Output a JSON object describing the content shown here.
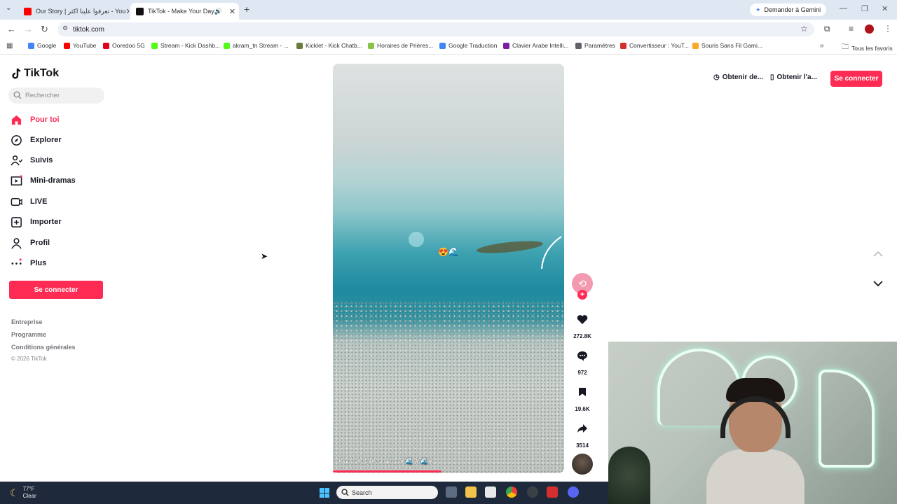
{
  "browser": {
    "tabs": [
      {
        "title": "Our Story | تعرفوا علينا اكثر - You",
        "active": false,
        "favicon_color": "#ff0000"
      },
      {
        "title": "TikTok - Make Your Day",
        "active": true,
        "favicon_color": "#111111"
      }
    ],
    "gemini_label": "Demander à Gemini",
    "url": "tiktok.com",
    "bookmarks": [
      {
        "label": "Google",
        "color": "#4285f4"
      },
      {
        "label": "YouTube",
        "color": "#ff0000"
      },
      {
        "label": "Ooredoo 5G",
        "color": "#e2001a"
      },
      {
        "label": "Stream - Kick Dashb...",
        "color": "#53fc18"
      },
      {
        "label": "akram_tn Stream - ...",
        "color": "#53fc18"
      },
      {
        "label": "Kicklet - Kick Chatb...",
        "color": "#6a7a3a"
      },
      {
        "label": "Horaires de Prières...",
        "color": "#8bc34a"
      },
      {
        "label": "Google Traduction",
        "color": "#4285f4"
      },
      {
        "label": "Clavier Arabe Intelli...",
        "color": "#7b1fa2"
      },
      {
        "label": "Paramètres",
        "color": "#5f6368"
      },
      {
        "label": "Convertisseur : YouT...",
        "color": "#d32f2f"
      },
      {
        "label": "Souris Sans Fil Gami...",
        "color": "#f9a825"
      }
    ],
    "all_bookmarks": "Tous les favoris"
  },
  "sidebar": {
    "logo": "TikTok",
    "search_placeholder": "Rechercher",
    "items": [
      {
        "label": "Pour toi",
        "icon": "home-icon",
        "active": true
      },
      {
        "label": "Explorer",
        "icon": "compass-icon",
        "active": false
      },
      {
        "label": "Suivis",
        "icon": "following-icon",
        "active": false
      },
      {
        "label": "Mini-dramas",
        "icon": "film-icon",
        "active": false
      },
      {
        "label": "LIVE",
        "icon": "live-icon",
        "active": false
      },
      {
        "label": "Importer",
        "icon": "upload-icon",
        "active": false
      },
      {
        "label": "Profil",
        "icon": "profile-icon",
        "active": false
      },
      {
        "label": "Plus",
        "icon": "more-icon",
        "active": false
      }
    ],
    "signin_label": "Se connecter",
    "footer_links": [
      "Entreprise",
      "Programme",
      "Conditions générales"
    ],
    "copyright": "© 2026 TikTok"
  },
  "header": {
    "get_coins": "Obtenir de...",
    "get_app": "Obtenir l'a...",
    "signin_label": "Se connecter"
  },
  "video": {
    "caption": "#مشاهدات#لايك#متابعه# 🌊 # 🌊#",
    "progress": 0.47,
    "actions": {
      "likes": "272.8K",
      "comments": "972",
      "saves": "19.6K",
      "shares": "3514"
    }
  },
  "taskbar": {
    "temperature": "77°F",
    "condition": "Clear",
    "search_placeholder": "Search"
  },
  "colors": {
    "accent": "#fe2c55",
    "text": "#161823"
  }
}
